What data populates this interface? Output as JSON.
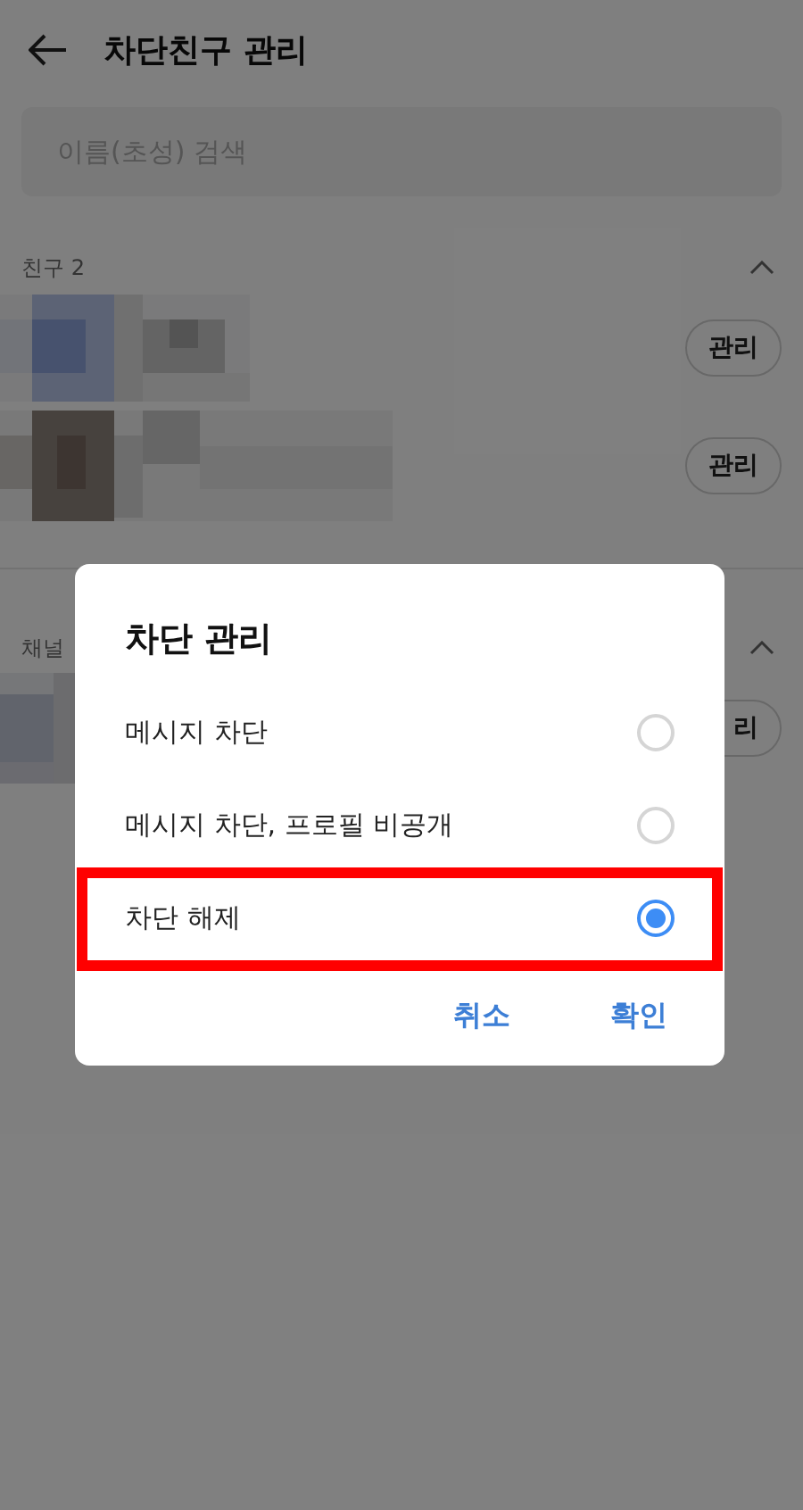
{
  "header": {
    "title": "차단친구 관리"
  },
  "search": {
    "placeholder": "이름(초성) 검색"
  },
  "sections": [
    {
      "title": "친구 2",
      "expanded": true,
      "rows": [
        {
          "kind": "picture",
          "button": "관리"
        },
        {
          "kind": "picture",
          "button": "관리"
        }
      ]
    },
    {
      "title": "채널",
      "expanded": true,
      "rows": [
        {
          "kind": "picture",
          "button": "리"
        }
      ]
    }
  ],
  "dialog": {
    "title": "차단 관리",
    "options": [
      {
        "label": "메시지 차단",
        "selected": false,
        "highlighted": false
      },
      {
        "label": "메시지 차단, 프로필 비공개",
        "selected": false,
        "highlighted": false
      },
      {
        "label": "차단 해제",
        "selected": true,
        "highlighted": true
      }
    ],
    "buttons": [
      "취소",
      "확인"
    ]
  }
}
